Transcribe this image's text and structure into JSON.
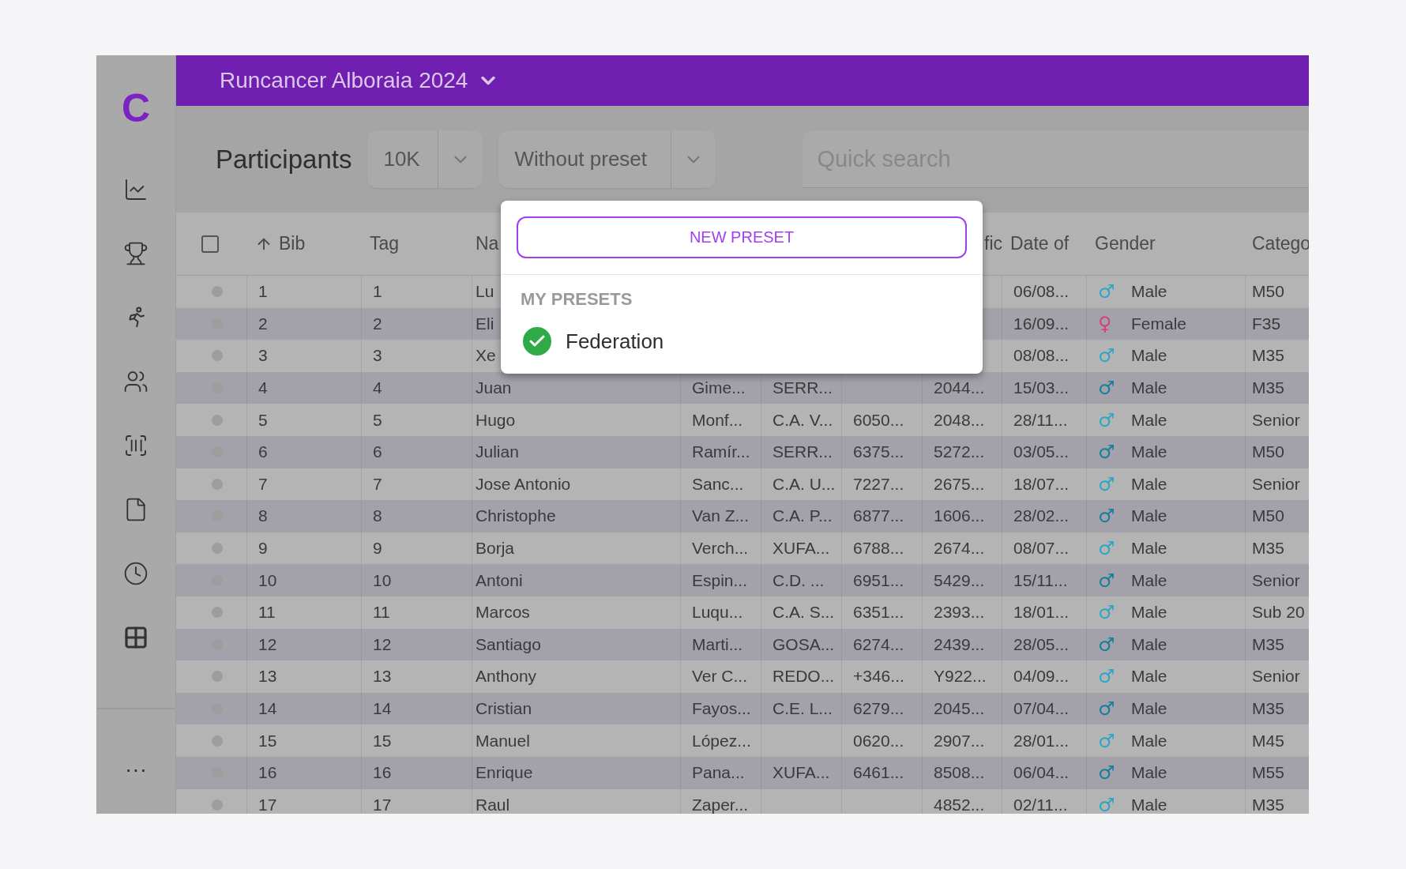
{
  "sidebar": {
    "logo": "C",
    "items": [
      {
        "kind": "chart"
      },
      {
        "kind": "trophy"
      },
      {
        "kind": "runner"
      },
      {
        "kind": "people"
      },
      {
        "kind": "barcode"
      },
      {
        "kind": "file"
      },
      {
        "kind": "clock"
      },
      {
        "kind": "grid"
      }
    ],
    "more": "···"
  },
  "header": {
    "event": "Runcancer Alboraia 2024"
  },
  "toolbar": {
    "title": "Participants",
    "distance": {
      "value": "10K"
    },
    "preset": {
      "value": "Without preset"
    },
    "search": {
      "placeholder": "Quick search"
    }
  },
  "table": {
    "select_all": {
      "checked": false
    },
    "columns": [
      {
        "label": "Bib",
        "sorted": true
      },
      {
        "label": "Tag",
        "sorted": false
      },
      {
        "label": "Na",
        "sorted": false
      },
      {
        "label": "fic",
        "sorted": false
      },
      {
        "label": "Date of",
        "sorted": false
      },
      {
        "label": "Gender",
        "sorted": false
      },
      {
        "label": "Catego",
        "sorted": false
      }
    ],
    "rows": [
      {
        "bib": "1",
        "tag": "1",
        "first_name": "Lu",
        "birth_date": "06/08...",
        "gender": "Male",
        "gender_symbol": "♂",
        "color": "#2aa7c6",
        "category": "M50"
      },
      {
        "bib": "2",
        "tag": "2",
        "first_name": "Eli",
        "birth_date": "16/09...",
        "gender": "Female",
        "gender_symbol": "♀",
        "color": "#d6417a",
        "category": "F35"
      },
      {
        "bib": "3",
        "tag": "3",
        "first_name": "Xe",
        "birth_date": "08/08...",
        "gender": "Male",
        "gender_symbol": "♂",
        "color": "#2aa7c6",
        "category": "M35"
      },
      {
        "bib": "4",
        "tag": "4",
        "first_name": "Juan",
        "last_name": "Gime...",
        "club": "SERR...",
        "column_8": "2044...",
        "birth_date": "15/03...",
        "gender": "Male",
        "gender_symbol": "♂",
        "color": "#137f9c",
        "category": "M35"
      },
      {
        "bib": "5",
        "tag": "5",
        "first_name": "Hugo",
        "last_name": "Monf...",
        "club": "C.A. V...",
        "phone": "6050...",
        "column_8": "2048...",
        "birth_date": "28/11...",
        "gender": "Male",
        "gender_symbol": "♂",
        "color": "#2aa7c6",
        "category": "Senior"
      },
      {
        "bib": "6",
        "tag": "6",
        "first_name": "Julian",
        "last_name": "Ramír...",
        "club": "SERR...",
        "phone": "6375...",
        "column_8": "5272...",
        "birth_date": "03/05...",
        "gender": "Male",
        "gender_symbol": "♂",
        "color": "#137f9c",
        "category": "M50"
      },
      {
        "bib": "7",
        "tag": "7",
        "first_name": "Jose Antonio",
        "last_name": "Sanc...",
        "club": "C.A. U...",
        "phone": "7227...",
        "column_8": "2675...",
        "birth_date": "18/07...",
        "gender": "Male",
        "gender_symbol": "♂",
        "color": "#2aa7c6",
        "category": "Senior"
      },
      {
        "bib": "8",
        "tag": "8",
        "first_name": "Christophe",
        "last_name": "Van Z...",
        "club": "C.A. P...",
        "phone": "6877...",
        "column_8": "1606...",
        "birth_date": "28/02...",
        "gender": "Male",
        "gender_symbol": "♂",
        "color": "#137f9c",
        "category": "M50"
      },
      {
        "bib": "9",
        "tag": "9",
        "first_name": "Borja",
        "last_name": "Verch...",
        "club": "XUFA...",
        "phone": "6788...",
        "column_8": "2674...",
        "birth_date": "08/07...",
        "gender": "Male",
        "gender_symbol": "♂",
        "color": "#2aa7c6",
        "category": "M35"
      },
      {
        "bib": "10",
        "tag": "10",
        "first_name": "Antoni",
        "last_name": "Espin...",
        "club": "C.D. ...",
        "phone": "6951...",
        "column_8": "5429...",
        "birth_date": "15/11...",
        "gender": "Male",
        "gender_symbol": "♂",
        "color": "#137f9c",
        "category": "Senior"
      },
      {
        "bib": "11",
        "tag": "11",
        "first_name": "Marcos",
        "last_name": "Luqu...",
        "club": "C.A. S...",
        "phone": "6351...",
        "column_8": "2393...",
        "birth_date": "18/01...",
        "gender": "Male",
        "gender_symbol": "♂",
        "color": "#2aa7c6",
        "category": "Sub 20"
      },
      {
        "bib": "12",
        "tag": "12",
        "first_name": "Santiago",
        "last_name": "Marti...",
        "club": "GOSA...",
        "phone": "6274...",
        "column_8": "2439...",
        "birth_date": "28/05...",
        "gender": "Male",
        "gender_symbol": "♂",
        "color": "#137f9c",
        "category": "M35"
      },
      {
        "bib": "13",
        "tag": "13",
        "first_name": "Anthony",
        "last_name": "Ver C...",
        "club": "REDO...",
        "phone": "+346...",
        "column_8": "Y922...",
        "birth_date": "04/09...",
        "gender": "Male",
        "gender_symbol": "♂",
        "color": "#2aa7c6",
        "category": "Senior"
      },
      {
        "bib": "14",
        "tag": "14",
        "first_name": "Cristian",
        "last_name": "Fayos...",
        "club": "C.E. L...",
        "phone": "6279...",
        "column_8": "2045...",
        "birth_date": "07/04...",
        "gender": "Male",
        "gender_symbol": "♂",
        "color": "#137f9c",
        "category": "M35"
      },
      {
        "bib": "15",
        "tag": "15",
        "first_name": "Manuel",
        "last_name": "López...",
        "phone": "0620...",
        "column_8": "2907...",
        "birth_date": "28/01...",
        "gender": "Male",
        "gender_symbol": "♂",
        "color": "#2aa7c6",
        "category": "M45"
      },
      {
        "bib": "16",
        "tag": "16",
        "first_name": "Enrique",
        "last_name": "Pana...",
        "club": "XUFA...",
        "phone": "6461...",
        "column_8": "8508...",
        "birth_date": "06/04...",
        "gender": "Male",
        "gender_symbol": "♂",
        "color": "#137f9c",
        "category": "M55"
      },
      {
        "bib": "17",
        "tag": "17",
        "first_name": "Raul",
        "last_name": "Zaper...",
        "column_8": "4852...",
        "birth_date": "02/11...",
        "gender": "Male",
        "gender_symbol": "♂",
        "color": "#2aa7c6",
        "category": "M35"
      }
    ]
  },
  "preset_menu": {
    "new_button": "NEW PRESET",
    "section": "MY PRESETS",
    "items": [
      {
        "label": "Federation",
        "selected": true
      }
    ]
  }
}
